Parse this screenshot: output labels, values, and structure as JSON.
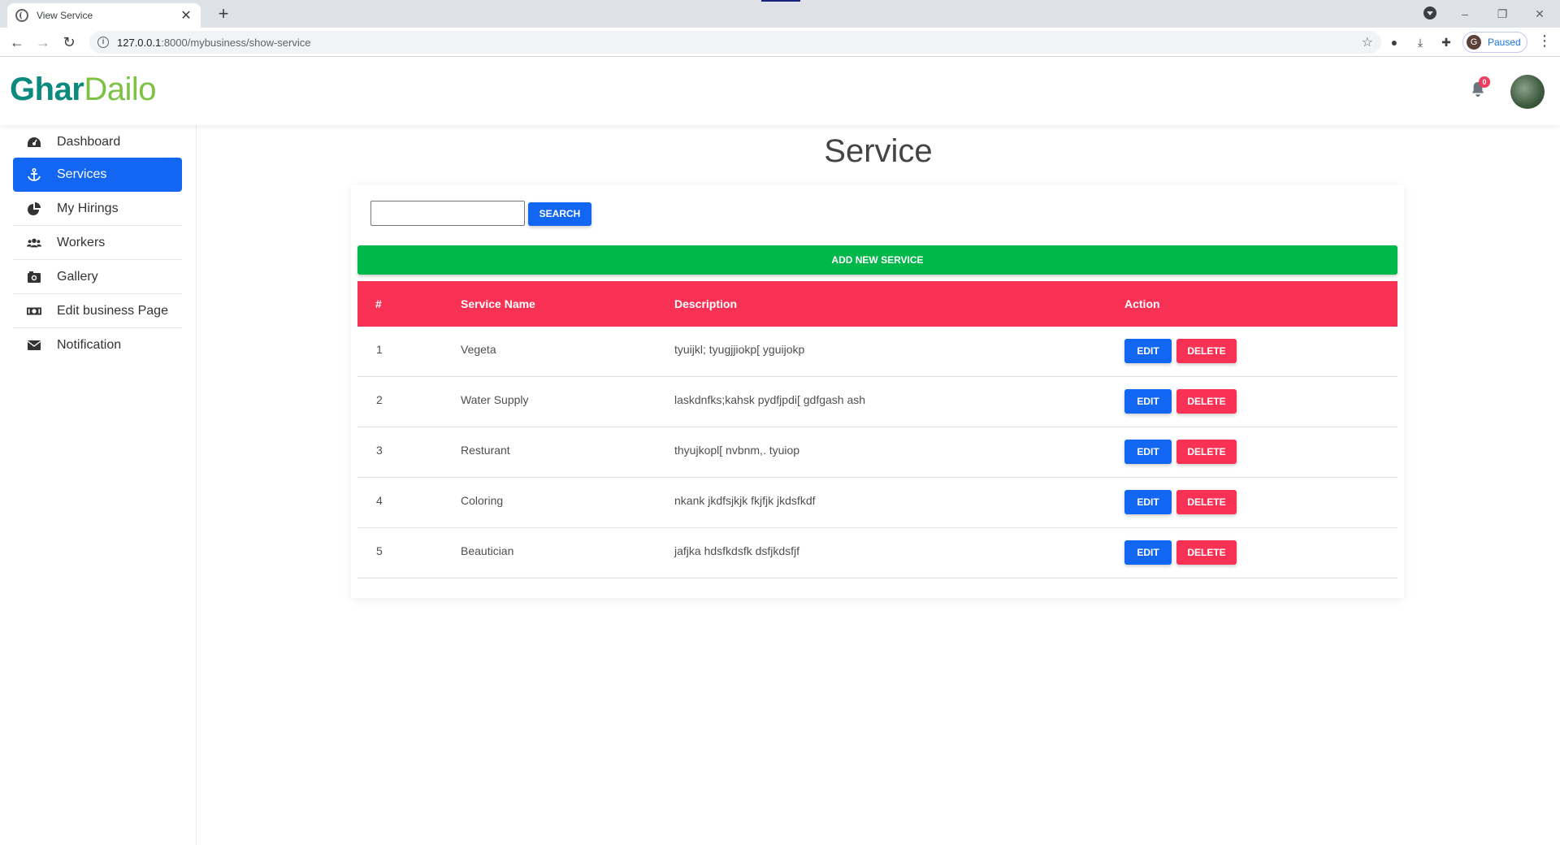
{
  "browser": {
    "tab_title": "View Service",
    "tab_close": "✕",
    "new_tab": "+",
    "url_host": "127.0.0.1",
    "url_path": ":8000/mybusiness/show-service",
    "profile_initial": "G",
    "profile_status": "Paused",
    "window_controls": [
      "–",
      "❐",
      "✕"
    ]
  },
  "header": {
    "logo_part1": "Ghar",
    "logo_part2": "Dailo",
    "notification_count": "0"
  },
  "sidebar": {
    "items": [
      {
        "label": "Dashboard",
        "icon": "dashboard-icon"
      },
      {
        "label": "Services",
        "icon": "anchor-icon",
        "active": true
      },
      {
        "label": "My Hirings",
        "icon": "pie-chart-icon"
      },
      {
        "label": "Workers",
        "icon": "users-icon"
      },
      {
        "label": "Gallery",
        "icon": "camera-icon"
      },
      {
        "label": "Edit business Page",
        "icon": "money-bill-icon"
      },
      {
        "label": "Notification",
        "icon": "envelope-icon"
      }
    ]
  },
  "main": {
    "title": "Service",
    "search_placeholder": "",
    "search_label": "SEARCH",
    "add_label": "ADD NEW SERVICE",
    "columns": [
      "#",
      "Service Name",
      "Description",
      "Action"
    ],
    "rows": [
      {
        "id": "1",
        "name": "Vegeta",
        "description": "tyuijkl; tyugjjiokp[ yguijokp"
      },
      {
        "id": "2",
        "name": "Water Supply",
        "description": "laskdnfks;kahsk pydfjpdi[ gdfgash ash"
      },
      {
        "id": "3",
        "name": "Resturant",
        "description": "thyujkopl[ nvbnm,. tyuiop"
      },
      {
        "id": "4",
        "name": "Coloring",
        "description": "nkank jkdfsjkjk fkjfjk jkdsfkdf"
      },
      {
        "id": "5",
        "name": "Beautician",
        "description": "jafjka hdsfkdsfk dsfjkdsfjf"
      }
    ],
    "edit_label": "EDIT",
    "delete_label": "DELETE"
  },
  "colors": {
    "primary": "#1266f1",
    "danger": "#f93154",
    "success": "#00b74a",
    "logo_dark": "#0b8a7e",
    "logo_light": "#7dc242"
  }
}
